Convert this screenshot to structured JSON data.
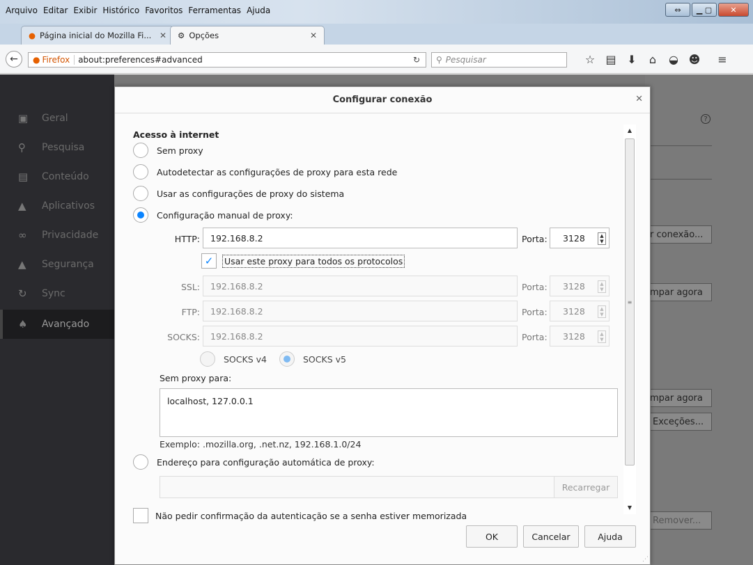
{
  "menubar": [
    "Arquivo",
    "Editar",
    "Exibir",
    "Histórico",
    "Favoritos",
    "Ferramentas",
    "Ajuda"
  ],
  "tabs": [
    {
      "label": "Página inicial do Mozilla Fi...",
      "icon": "firefox-icon"
    },
    {
      "label": "Opções",
      "icon": "gear-icon"
    }
  ],
  "urlbar": {
    "identity": "Firefox",
    "url": "about:preferences#advanced"
  },
  "search": {
    "placeholder": "Pesquisar"
  },
  "sidebar": [
    {
      "label": "Geral",
      "icon": "general-icon"
    },
    {
      "label": "Pesquisa",
      "icon": "search-icon"
    },
    {
      "label": "Conteúdo",
      "icon": "content-icon"
    },
    {
      "label": "Aplicativos",
      "icon": "applications-icon"
    },
    {
      "label": "Privacidade",
      "icon": "privacy-mask-icon"
    },
    {
      "label": "Segurança",
      "icon": "lock-icon"
    },
    {
      "label": "Sync",
      "icon": "sync-icon"
    },
    {
      "label": "Avançado",
      "icon": "wizard-hat-icon"
    }
  ],
  "background_buttons": {
    "configure": "r conexão...",
    "clear1": "mpar agora",
    "clear2": "mpar agora",
    "exceptions": "Exceções...",
    "remove": "Remover..."
  },
  "dialog": {
    "title": "Configurar conexão",
    "section": "Acesso à internet",
    "options": [
      {
        "label": "Sem proxy",
        "checked": false
      },
      {
        "label": "Autodetectar as configurações de proxy para esta rede",
        "checked": false
      },
      {
        "label": "Usar as configurações de proxy do sistema",
        "checked": false
      },
      {
        "label": "Configuração manual de proxy:",
        "checked": true
      }
    ],
    "http": {
      "label": "HTTP:",
      "value": "192.168.8.2",
      "port_label": "Porta:",
      "port": "3128"
    },
    "use_all": "Usar este proxy para todos os protocolos",
    "ssl": {
      "label": "SSL:",
      "value": "192.168.8.2",
      "port_label": "Porta:",
      "port": "3128"
    },
    "ftp": {
      "label": "FTP:",
      "value": "192.168.8.2",
      "port_label": "Porta:",
      "port": "3128"
    },
    "socks": {
      "label": "SOCKS:",
      "value": "192.168.8.2",
      "port_label": "Porta:",
      "port": "3128"
    },
    "socks_v4": "SOCKS v4",
    "socks_v5": "SOCKS v5",
    "no_proxy_label": "Sem proxy para:",
    "no_proxy_value": "localhost, 127.0.0.1",
    "example": "Exemplo: .mozilla.org, .net.nz, 192.168.1.0/24",
    "auto_url_label": "Endereço para configuração automática de proxy:",
    "reload": "Recarregar",
    "no_auth": "Não pedir confirmação da autenticação se a senha estiver memorizada",
    "ok": "OK",
    "cancel": "Cancelar",
    "help": "Ajuda"
  },
  "colors": {
    "accent": "#0a84ff",
    "sidebar_bg": "#2a2a2e"
  }
}
